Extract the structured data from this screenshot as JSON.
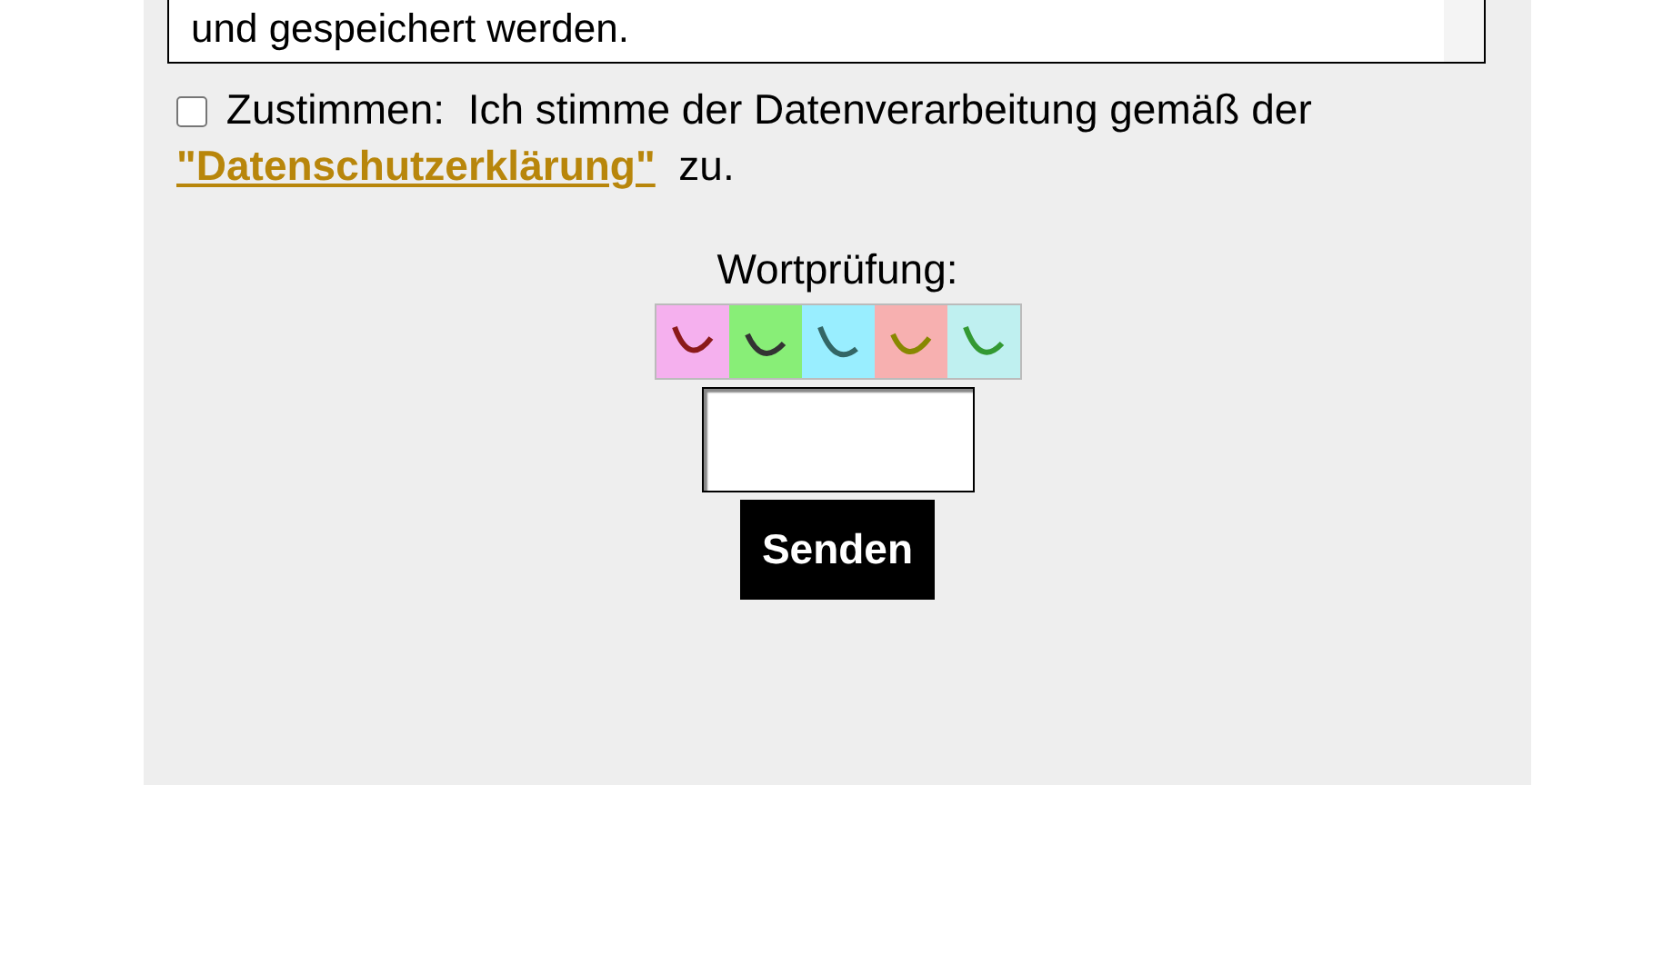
{
  "message": {
    "value": "und gespeichert werden."
  },
  "consent": {
    "checked": false,
    "label": "Zustimmen:",
    "text": "Ich stimme der Datenverarbeitung gemäß der",
    "link": "\"Datenschutzerklärung\"",
    "after": "zu."
  },
  "captcha": {
    "label": "Wortprüfung:"
  },
  "submit": "Senden"
}
